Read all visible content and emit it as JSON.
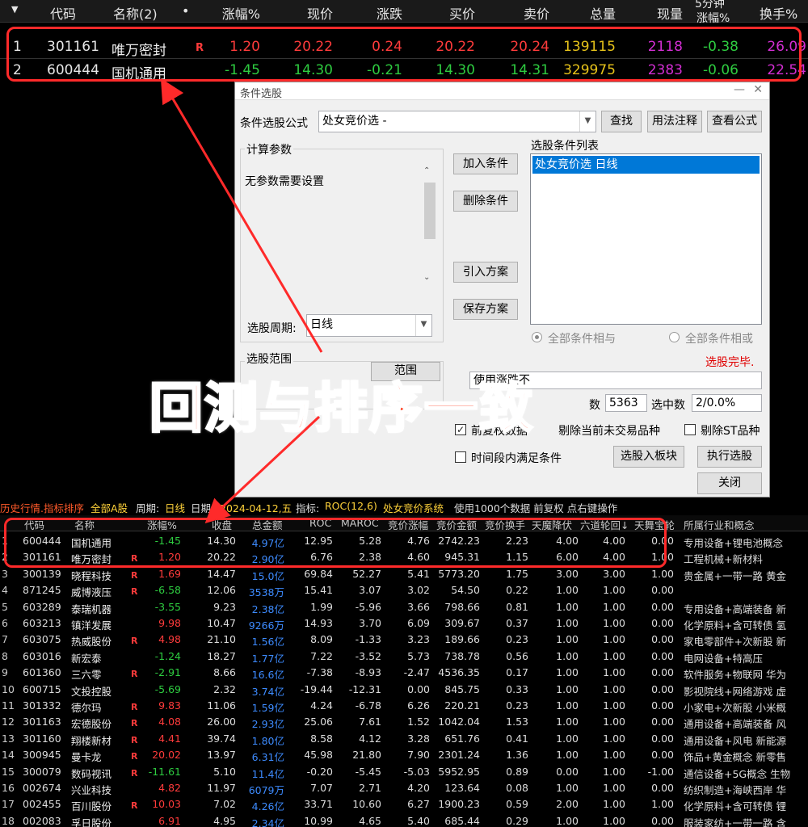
{
  "top_table": {
    "headers": [
      "代码",
      "名称(2)",
      "•",
      "涨幅%",
      "现价",
      "涨跌",
      "买价",
      "卖价",
      "总量",
      "现量",
      "5分钟",
      "涨幅%",
      "换手%"
    ],
    "rows": [
      {
        "idx": "1",
        "code": "301161",
        "name": "唯万密封",
        "flag": "R",
        "pct": "1.20",
        "price": "20.22",
        "chg": "0.24",
        "bid": "20.22",
        "ask": "20.24",
        "vol": "139115",
        "cur": "2118",
        "m5": "-0.38",
        "turn": "26.09"
      },
      {
        "idx": "2",
        "code": "600444",
        "name": "国机通用",
        "flag": "",
        "pct": "-1.45",
        "price": "14.30",
        "chg": "-0.21",
        "bid": "14.30",
        "ask": "14.31",
        "vol": "329975",
        "cur": "2383",
        "m5": "-0.06",
        "turn": "22.54"
      }
    ]
  },
  "dialog": {
    "title": "条件选股",
    "formula_label": "条件选股公式",
    "formula_value": "处女竞价选  -",
    "btn_find": "查找",
    "btn_usage": "用法注释",
    "btn_view": "查看公式",
    "params_legend": "计算参数",
    "params_text": "无参数需要设置",
    "btn_add": "加入条件",
    "btn_del": "删除条件",
    "btn_import": "引入方案",
    "btn_save": "保存方案",
    "list_title": "选股条件列表",
    "list_item": "处女竞价选  日线",
    "radio_and": "全部条件相与",
    "radio_or": "全部条件相或",
    "done_text": "选股完毕.",
    "period_label": "选股周期:",
    "period_value": "日线",
    "range_legend": "选股范围",
    "range_btn": "范围",
    "use_rise": "使用涨跌不",
    "count_label": "数",
    "count_value": "5363",
    "selected_label": "选中数",
    "selected_value": "2/0.0%",
    "fq_label": "前复权数据",
    "excl_label": "剔除当前未交易品种",
    "st_label": "剔除ST品种",
    "timeseg_label": "时间段内满足条件",
    "btn_to_block": "选股入板块",
    "btn_run": "执行选股",
    "btn_close": "关闭"
  },
  "overlay_text": "回测与排序一致",
  "history": {
    "status": {
      "a": "历史行情.指标排序",
      "b": "全部A股",
      "c": "周期:",
      "d": "日线",
      "e": "日期:",
      "f": "2024-04-12,五",
      "g": "指标:",
      "h": "ROC(12,6)",
      "i": "处女竞价系统",
      "j": "使用1000个数据 前复权 点右键操作"
    },
    "headers": [
      "代码",
      "名称",
      "涨幅%",
      "收盘",
      "总金额",
      "ROC",
      "MAROC",
      "竞价涨幅",
      "竞价金额",
      "竞价换手",
      "天魔降伏",
      "六道轮回↓",
      "天舞宝轮",
      "所属行业和概念"
    ],
    "rows": [
      {
        "i": "1",
        "code": "600444",
        "name": "国机通用",
        "r": "",
        "pct": "-1.45",
        "close": "14.30",
        "amt": "4.97亿",
        "roc": "12.95",
        "maroc": "5.28",
        "jjzf": "4.76",
        "jjje": "2742.23",
        "jjhs": "2.23",
        "tm": "4.00",
        "ld": "4.00",
        "tw": "0.00",
        "ind": "专用设备+锂电池概念"
      },
      {
        "i": "2",
        "code": "301161",
        "name": "唯万密封",
        "r": "R",
        "pct": "1.20",
        "close": "20.22",
        "amt": "2.90亿",
        "roc": "6.76",
        "maroc": "2.38",
        "jjzf": "4.60",
        "jjje": "945.31",
        "jjhs": "1.15",
        "tm": "6.00",
        "ld": "4.00",
        "tw": "1.00",
        "ind": "工程机械+新材料"
      },
      {
        "i": "3",
        "code": "300139",
        "name": "晓程科技",
        "r": "R",
        "pct": "1.69",
        "close": "14.47",
        "amt": "15.0亿",
        "roc": "69.84",
        "maroc": "52.27",
        "jjzf": "5.41",
        "jjje": "5773.20",
        "jjhs": "1.75",
        "tm": "3.00",
        "ld": "3.00",
        "tw": "1.00",
        "ind": "贵金属+一带一路 黄金"
      },
      {
        "i": "4",
        "code": "871245",
        "name": "威博液压",
        "r": "R",
        "pct": "-6.58",
        "close": "12.06",
        "amt": "3538万",
        "roc": "15.41",
        "maroc": "3.07",
        "jjzf": "3.02",
        "jjje": "54.50",
        "jjhs": "0.22",
        "tm": "1.00",
        "ld": "1.00",
        "tw": "0.00",
        "ind": ""
      },
      {
        "i": "5",
        "code": "603289",
        "name": "泰瑞机器",
        "r": "",
        "pct": "-3.55",
        "close": "9.23",
        "amt": "2.38亿",
        "roc": "1.99",
        "maroc": "-5.96",
        "jjzf": "3.66",
        "jjje": "798.66",
        "jjhs": "0.81",
        "tm": "1.00",
        "ld": "1.00",
        "tw": "0.00",
        "ind": "专用设备+高端装备 新"
      },
      {
        "i": "6",
        "code": "603213",
        "name": "镇洋发展",
        "r": "",
        "pct": "9.98",
        "close": "10.47",
        "amt": "9266万",
        "roc": "14.93",
        "maroc": "3.70",
        "jjzf": "6.09",
        "jjje": "309.67",
        "jjhs": "0.37",
        "tm": "1.00",
        "ld": "1.00",
        "tw": "0.00",
        "ind": "化学原料+含可转债 氢"
      },
      {
        "i": "7",
        "code": "603075",
        "name": "热威股份",
        "r": "R",
        "pct": "4.98",
        "close": "21.10",
        "amt": "1.56亿",
        "roc": "8.09",
        "maroc": "-1.33",
        "jjzf": "3.23",
        "jjje": "189.66",
        "jjhs": "0.23",
        "tm": "1.00",
        "ld": "1.00",
        "tw": "0.00",
        "ind": "家电零部件+次新股 新"
      },
      {
        "i": "8",
        "code": "603016",
        "name": "新宏泰",
        "r": "",
        "pct": "-1.24",
        "close": "18.27",
        "amt": "1.77亿",
        "roc": "7.22",
        "maroc": "-3.52",
        "jjzf": "5.73",
        "jjje": "738.78",
        "jjhs": "0.56",
        "tm": "1.00",
        "ld": "1.00",
        "tw": "0.00",
        "ind": "电网设备+特高压"
      },
      {
        "i": "9",
        "code": "601360",
        "name": "三六零",
        "r": "R",
        "pct": "-2.91",
        "close": "8.66",
        "amt": "16.6亿",
        "roc": "-7.38",
        "maroc": "-8.93",
        "jjzf": "-2.47",
        "jjje": "4536.35",
        "jjhs": "0.17",
        "tm": "1.00",
        "ld": "1.00",
        "tw": "0.00",
        "ind": "软件服务+物联网 华为"
      },
      {
        "i": "10",
        "code": "600715",
        "name": "文投控股",
        "r": "",
        "pct": "-5.69",
        "close": "2.32",
        "amt": "3.74亿",
        "roc": "-19.44",
        "maroc": "-12.31",
        "jjzf": "0.00",
        "jjje": "845.75",
        "jjhs": "0.33",
        "tm": "1.00",
        "ld": "1.00",
        "tw": "0.00",
        "ind": "影视院线+网络游戏 虚"
      },
      {
        "i": "11",
        "code": "301332",
        "name": "德尔玛",
        "r": "R",
        "pct": "9.83",
        "close": "11.06",
        "amt": "1.59亿",
        "roc": "4.24",
        "maroc": "-6.78",
        "jjzf": "6.26",
        "jjje": "220.21",
        "jjhs": "0.23",
        "tm": "1.00",
        "ld": "1.00",
        "tw": "0.00",
        "ind": "小家电+次新股 小米概"
      },
      {
        "i": "12",
        "code": "301163",
        "name": "宏德股份",
        "r": "R",
        "pct": "4.08",
        "close": "26.00",
        "amt": "2.93亿",
        "roc": "25.06",
        "maroc": "7.61",
        "jjzf": "1.52",
        "jjje": "1042.04",
        "jjhs": "1.53",
        "tm": "1.00",
        "ld": "1.00",
        "tw": "0.00",
        "ind": "通用设备+高端装备 风"
      },
      {
        "i": "13",
        "code": "301160",
        "name": "翔楼新材",
        "r": "R",
        "pct": "4.41",
        "close": "39.74",
        "amt": "1.80亿",
        "roc": "8.58",
        "maroc": "4.12",
        "jjzf": "3.28",
        "jjje": "651.76",
        "jjhs": "0.41",
        "tm": "1.00",
        "ld": "1.00",
        "tw": "0.00",
        "ind": "通用设备+风电 新能源"
      },
      {
        "i": "14",
        "code": "300945",
        "name": "曼卡龙",
        "r": "R",
        "pct": "20.02",
        "close": "13.97",
        "amt": "6.31亿",
        "roc": "45.98",
        "maroc": "21.80",
        "jjzf": "7.90",
        "jjje": "2301.24",
        "jjhs": "1.36",
        "tm": "1.00",
        "ld": "1.00",
        "tw": "0.00",
        "ind": "饰品+黄金概念 新零售"
      },
      {
        "i": "15",
        "code": "300079",
        "name": "数码视讯",
        "r": "R",
        "pct": "-11.61",
        "close": "5.10",
        "amt": "11.4亿",
        "roc": "-0.20",
        "maroc": "-5.45",
        "jjzf": "-5.03",
        "jjje": "5952.95",
        "jjhs": "0.89",
        "tm": "0.00",
        "ld": "1.00",
        "tw": "-1.00",
        "ind": "通信设备+5G概念 生物"
      },
      {
        "i": "16",
        "code": "002674",
        "name": "兴业科技",
        "r": "",
        "pct": "4.82",
        "close": "11.97",
        "amt": "6079万",
        "roc": "7.07",
        "maroc": "2.71",
        "jjzf": "4.20",
        "jjje": "123.64",
        "jjhs": "0.08",
        "tm": "1.00",
        "ld": "1.00",
        "tw": "0.00",
        "ind": "纺织制造+海峡西岸 华"
      },
      {
        "i": "17",
        "code": "002455",
        "name": "百川股份",
        "r": "R",
        "pct": "10.03",
        "close": "7.02",
        "amt": "4.26亿",
        "roc": "33.71",
        "maroc": "10.60",
        "jjzf": "6.27",
        "jjje": "1900.23",
        "jjhs": "0.59",
        "tm": "2.00",
        "ld": "1.00",
        "tw": "1.00",
        "ind": "化学原料+含可转债 锂"
      },
      {
        "i": "18",
        "code": "002083",
        "name": "孚日股份",
        "r": "",
        "pct": "6.91",
        "close": "4.95",
        "amt": "2.34亿",
        "roc": "10.99",
        "maroc": "4.65",
        "jjzf": "5.40",
        "jjje": "685.44",
        "jjhs": "0.29",
        "tm": "1.00",
        "ld": "1.00",
        "tw": "0.00",
        "ind": "服装家纺+一带一路 含"
      }
    ]
  },
  "colors": {
    "up": "#ff3b3b",
    "down": "#2ecc40",
    "vol": "#e6c21a",
    "cur": "#d32ed3",
    "accent_red": "#ff2a2a"
  }
}
